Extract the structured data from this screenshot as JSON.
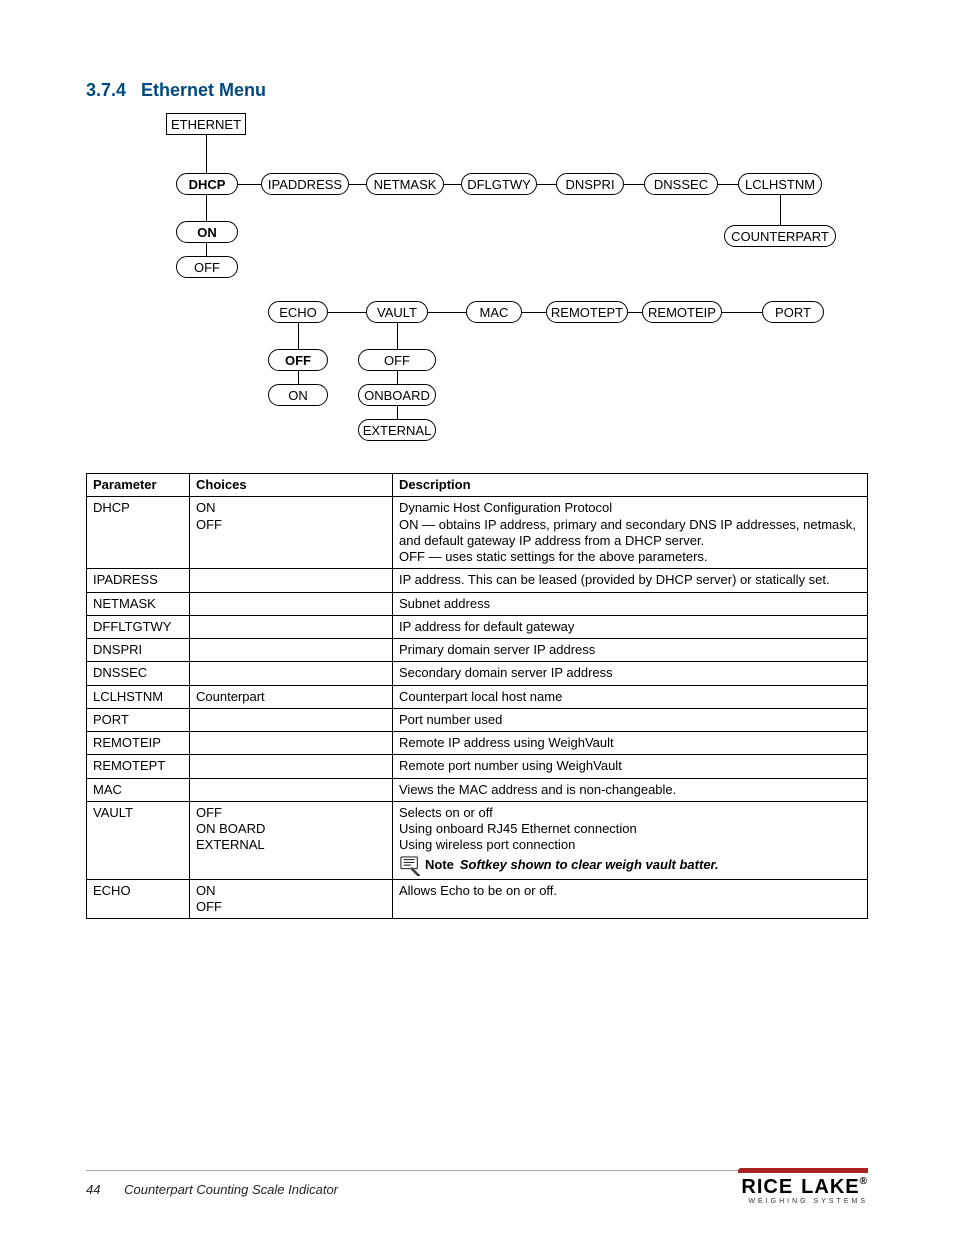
{
  "section": {
    "number": "3.7.4",
    "title": "Ethernet Menu"
  },
  "diagram": {
    "root": "ETHERNET",
    "row1": [
      "DHCP",
      "IPADDRESS",
      "NETMASK",
      "DFLGTWY",
      "DNSPRI",
      "DNSSEC",
      "LCLHSTNM"
    ],
    "dhcp_options": [
      "ON",
      "OFF"
    ],
    "lcl_child": "COUNTERPART",
    "row2": [
      "ECHO",
      "VAULT",
      "MAC",
      "REMOTEPT",
      "REMOTEIP",
      "PORT"
    ],
    "echo_options": [
      "OFF",
      "ON"
    ],
    "vault_options": [
      "OFF",
      "ONBOARD",
      "EXTERNAL"
    ]
  },
  "table": {
    "headers": [
      "Parameter",
      "Choices",
      "Description"
    ],
    "rows": [
      {
        "param": "DHCP",
        "choices": "ON\nOFF",
        "desc": "Dynamic Host Configuration Protocol\nON — obtains IP address, primary and secondary DNS IP addresses, netmask, and default gateway IP address from a DHCP server.\nOFF — uses static settings for the above parameters."
      },
      {
        "param": "IPADRESS",
        "choices": "",
        "desc": "IP address. This can be leased (provided by DHCP server) or statically set."
      },
      {
        "param": "NETMASK",
        "choices": "",
        "desc": "Subnet address"
      },
      {
        "param": "DFFLTGTWY",
        "choices": "",
        "desc": "IP address for default gateway"
      },
      {
        "param": "DNSPRI",
        "choices": "",
        "desc": "Primary domain server IP address"
      },
      {
        "param": "DNSSEC",
        "choices": "",
        "desc": "Secondary domain server IP address"
      },
      {
        "param": "LCLHSTNM",
        "choices": "Counterpart",
        "desc": "Counterpart local host name"
      },
      {
        "param": "PORT",
        "choices": "",
        "desc": "Port number used"
      },
      {
        "param": "REMOTEIP",
        "choices": "",
        "desc": "Remote IP address using WeighVault"
      },
      {
        "param": "REMOTEPT",
        "choices": "",
        "desc": "Remote port number using WeighVault"
      },
      {
        "param": "MAC",
        "choices": "",
        "desc": "Views the MAC address and is non-changeable."
      },
      {
        "param": "VAULT",
        "choices": "OFF\nON BOARD\nEXTERNAL",
        "desc": "Selects on or off\nUsing onboard RJ45 Ethernet connection\nUsing wireless port connection",
        "note_label": "Note",
        "note_text": "Softkey shown to clear weigh vault batter."
      },
      {
        "param": "ECHO",
        "choices": "ON\nOFF",
        "desc": "Allows Echo to be on or off."
      }
    ]
  },
  "footer": {
    "page": "44",
    "doc": "Counterpart Counting Scale Indicator",
    "logo_main": "RICE LAKE",
    "logo_sub": "WEIGHING SYSTEMS"
  }
}
